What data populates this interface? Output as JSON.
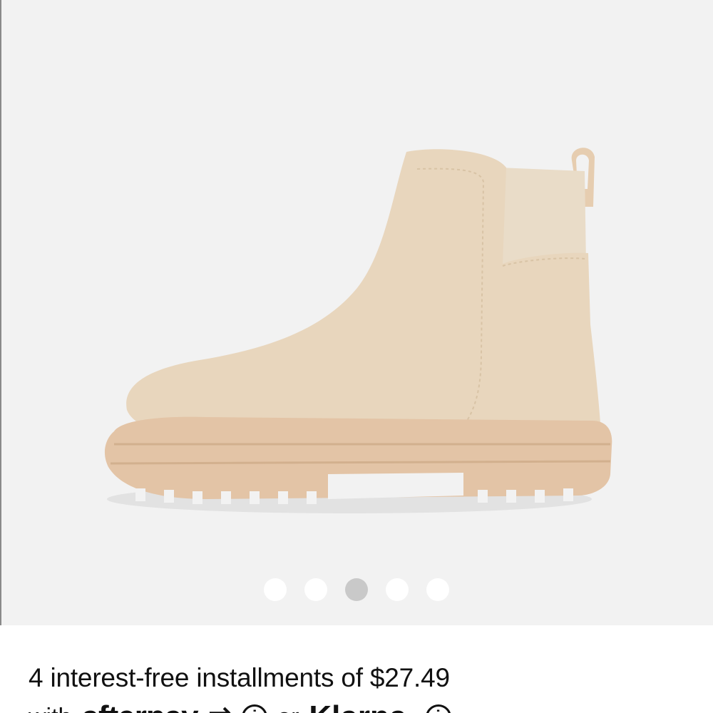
{
  "gallery": {
    "image_icon": "ankle-boot-image",
    "image_color": "#e8d6bd",
    "sole_color": "#e3c4a6",
    "background_color": "#f2f2f2",
    "dots": [
      {
        "label": "1",
        "active": false
      },
      {
        "label": "2",
        "active": false
      },
      {
        "label": "3",
        "active": true
      },
      {
        "label": "4",
        "active": false
      },
      {
        "label": "5",
        "active": false
      }
    ]
  },
  "payment": {
    "installments_text": "4 interest-free installments of $27.49",
    "with_text": "with",
    "afterpay_label": "afterpay",
    "or_text": "or",
    "klarna_label": "Klarna."
  }
}
